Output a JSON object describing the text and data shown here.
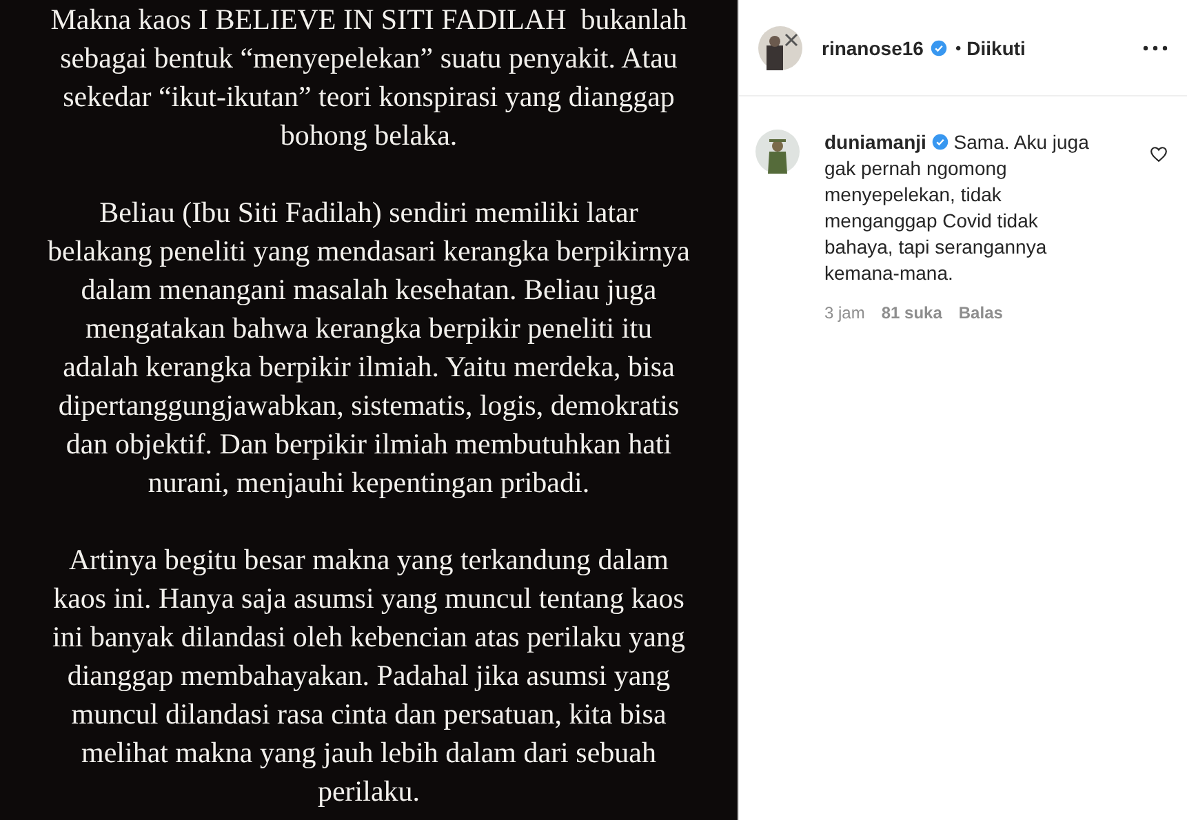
{
  "post_text": {
    "paragraphs": [
      [
        "Makna kaos I BELIEVE IN SITI FADILAH  bukanlah",
        "sebagai bentuk “menyepelekan” suatu penyakit. Atau",
        "sekedar “ikut-ikutan” teori konspirasi yang dianggap",
        "bohong belaka."
      ],
      [
        "Beliau (Ibu Siti Fadilah) sendiri memiliki latar",
        "belakang peneliti yang mendasari kerangka berpikirnya",
        "dalam menangani masalah kesehatan. Beliau juga",
        "mengatakan bahwa kerangka berpikir peneliti itu",
        "adalah kerangka berpikir ilmiah. Yaitu merdeka, bisa",
        "dipertanggungjawabkan, sistematis, logis, demokratis",
        "dan objektif. Dan berpikir ilmiah membutuhkan hati",
        "nurani, menjauhi kepentingan pribadi."
      ],
      [
        "Artinya begitu besar makna yang terkandung dalam",
        "kaos ini. Hanya saja asumsi yang muncul tentang kaos",
        "ini banyak dilandasi oleh kebencian atas perilaku yang",
        "dianggap membahayakan. Padahal jika asumsi yang",
        "muncul dilandasi rasa cinta dan persatuan, kita bisa",
        "melihat makna yang jauh lebih dalam dari sebuah",
        "perilaku."
      ]
    ]
  },
  "header": {
    "username": "rinanose16",
    "verified": true,
    "separator": "•",
    "follow_label": "Diikuti"
  },
  "comments": [
    {
      "username": "duniamanji",
      "verified": true,
      "text": "Sama. Aku juga gak pernah ngomong menyepelekan, tidak menganggap Covid tidak bahaya, tapi serangannya kemana-mana.",
      "liked": false,
      "time": "3 jam",
      "likes": "81 suka",
      "reply_label": "Balas"
    }
  ]
}
